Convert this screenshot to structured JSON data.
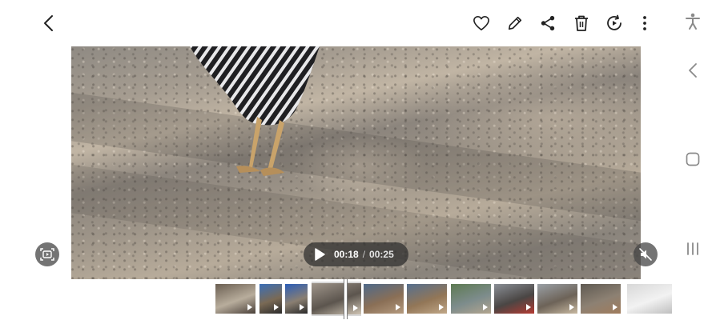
{
  "toolbar": {
    "back_icon": "chevron-left-icon",
    "actions": [
      "heart-icon",
      "pencil-icon",
      "share-icon",
      "trash-icon",
      "remaster-icon",
      "more-vertical-icon"
    ]
  },
  "playback": {
    "current_time": "00:18",
    "separator": "/",
    "total_time": "00:25",
    "state_icon": "play-icon"
  },
  "side_controls": {
    "left": "screen-capture-video-icon",
    "right": "mute-icon"
  },
  "system_nav": [
    "accessibility-icon",
    "back-icon",
    "home-icon",
    "recents-icon"
  ],
  "filmstrip": {
    "thumbnails": [
      {
        "id": 1,
        "colors": [
          "#6b5f52",
          "#b8ad9c",
          "#4a4039"
        ]
      },
      {
        "id": 2,
        "colors": [
          "#3b6fb7",
          "#7a6a55",
          "#2b2b2b"
        ]
      },
      {
        "id": 3,
        "colors": [
          "#2a5db8",
          "#8a7f72",
          "#2a2a2a"
        ]
      },
      {
        "id": 4,
        "colors": [
          "#9f958a",
          "#5c554e",
          "#cfc4b4"
        ],
        "current": true
      },
      {
        "id": 5,
        "colors": [
          "#4f6a8a",
          "#8a6f56",
          "#b49a7e"
        ]
      },
      {
        "id": 6,
        "colors": [
          "#56708f",
          "#927657",
          "#c0a788"
        ]
      },
      {
        "id": 7,
        "colors": [
          "#5d7a52",
          "#7d8c8c",
          "#b3a58f"
        ]
      },
      {
        "id": 8,
        "colors": [
          "#8a8f96",
          "#4a4644",
          "#b43a32"
        ]
      },
      {
        "id": 9,
        "colors": [
          "#9aa0a6",
          "#6d6358",
          "#c8b9a1"
        ]
      },
      {
        "id": 10,
        "colors": [
          "#5f5a52",
          "#8d8173",
          "#a07c5c"
        ]
      },
      {
        "id": 11,
        "colors": [
          "#d8d8d8",
          "#f2f2f2",
          "#bfbfbf"
        ]
      }
    ]
  }
}
